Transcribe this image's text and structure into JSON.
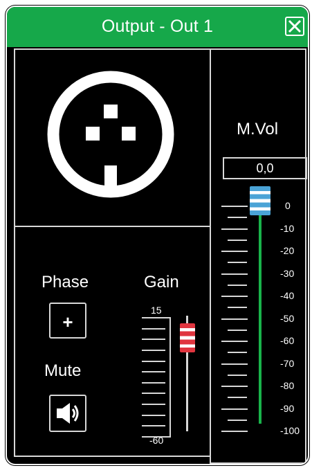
{
  "window": {
    "title": "Output - Out 1"
  },
  "titlebar": {
    "color": "#16a84a",
    "close_icon": "close-icon"
  },
  "connector": {
    "icon": "xlr-output-connector-icon"
  },
  "controls": {
    "phase": {
      "label": "Phase",
      "button_symbol": "+"
    },
    "mute": {
      "label": "Mute",
      "icon": "speaker-icon"
    },
    "gain": {
      "label": "Gain",
      "scale_top": "15",
      "scale_bottom": "-60",
      "handle_color": "#e0353f"
    }
  },
  "master_volume": {
    "label": "M.Vol",
    "value": "0,0",
    "scale": [
      "0",
      "-10",
      "-20",
      "-30",
      "-40",
      "-50",
      "-60",
      "-70",
      "-80",
      "-90",
      "-100"
    ],
    "handle_color": "#4aa3d6",
    "track_color": "#19b34a"
  }
}
